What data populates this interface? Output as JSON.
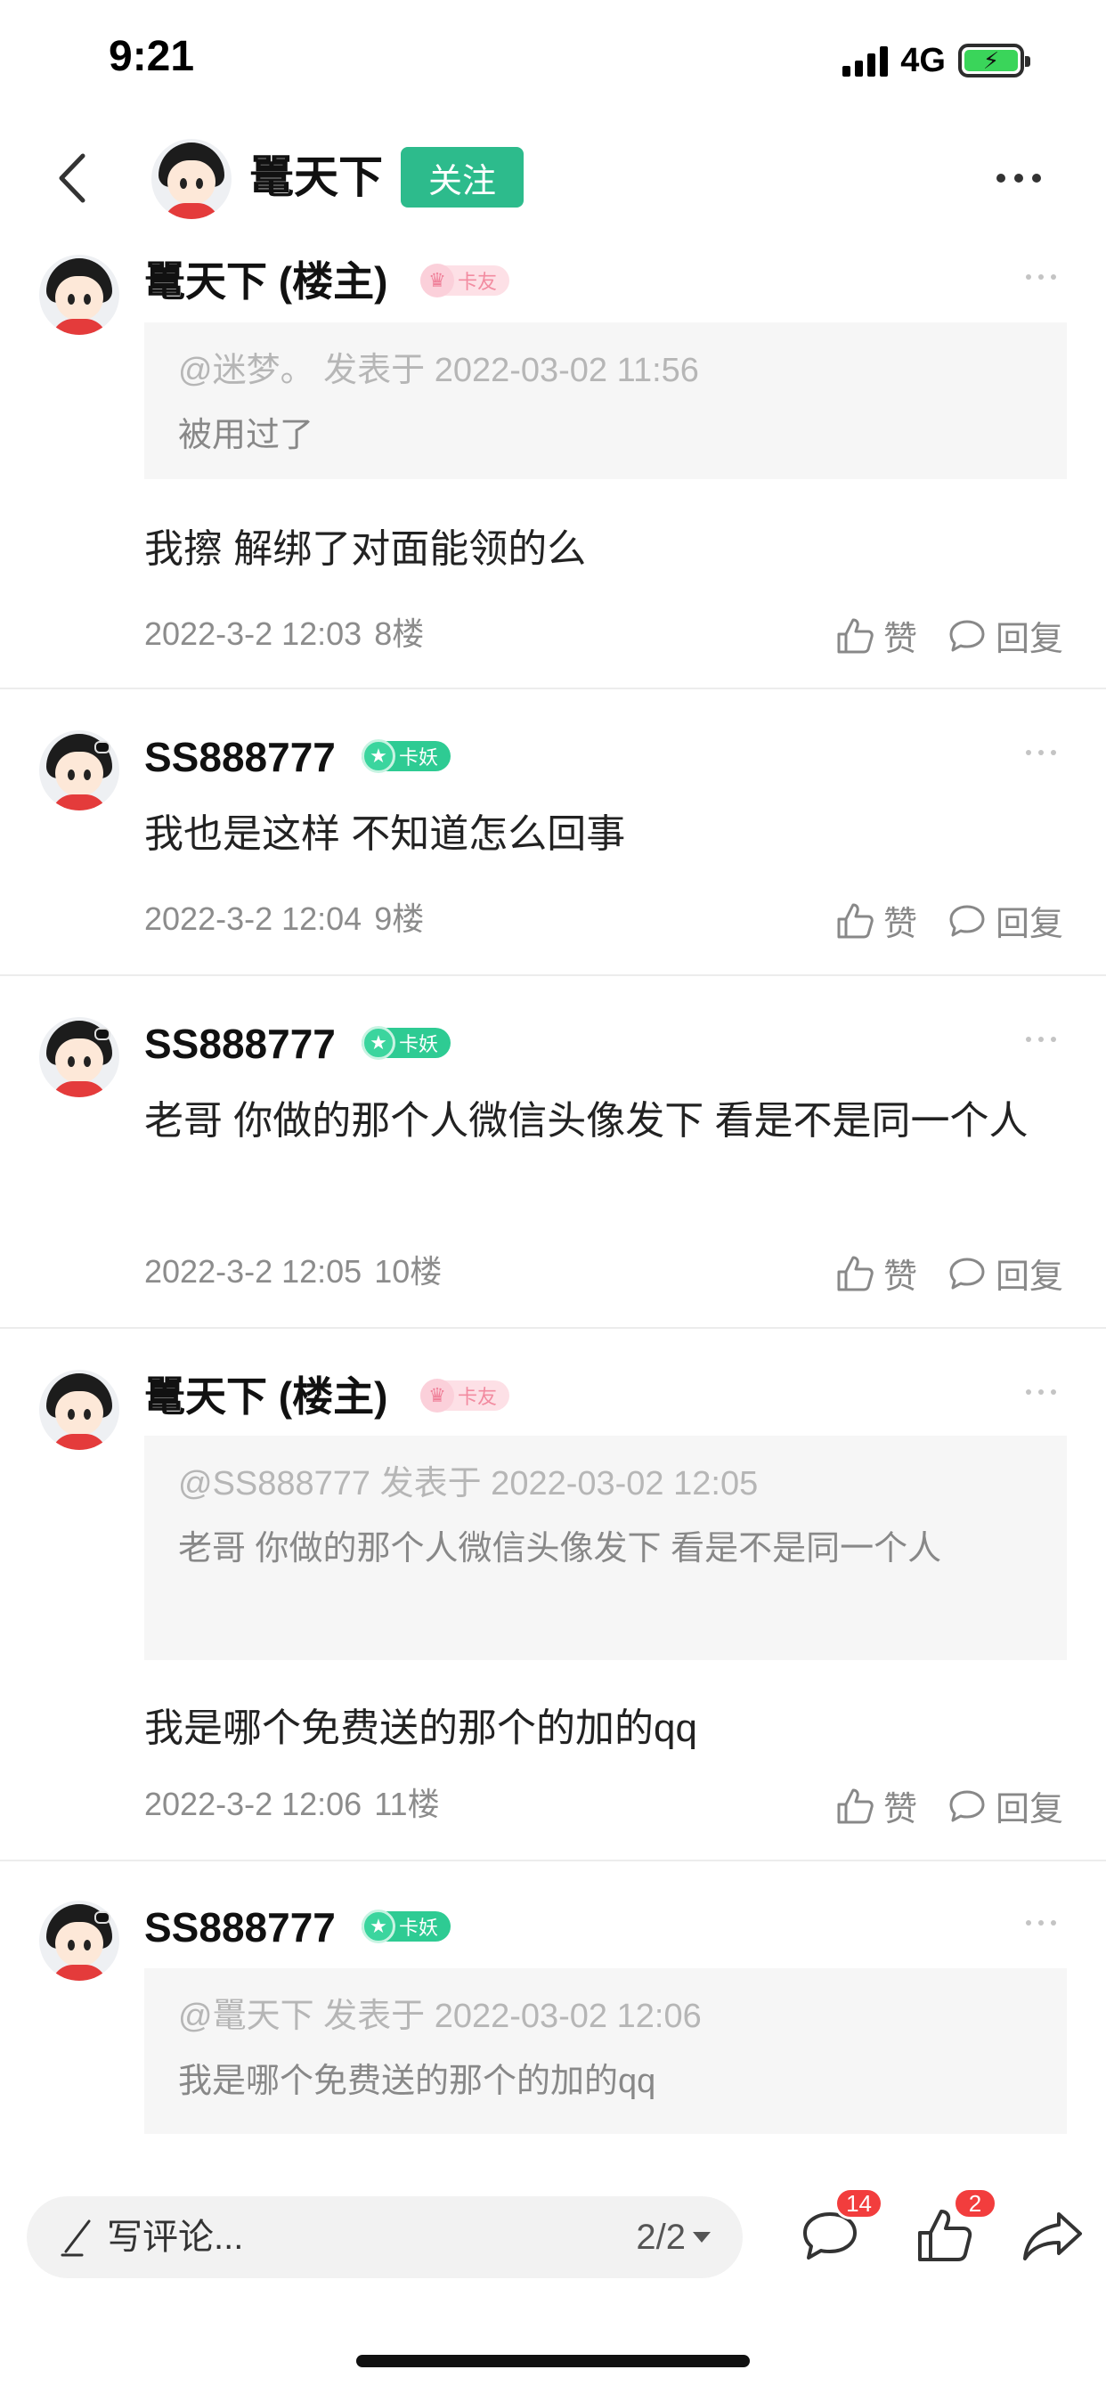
{
  "status_bar": {
    "time": "9:21",
    "network": "4G"
  },
  "nav": {
    "title": "鼍天下",
    "follow_label": "关注"
  },
  "posts": [
    {
      "name": "鼍天下 (楼主)",
      "badge": "卡友",
      "quote_meta": "@迷梦。 发表于 2022-03-02 11:56",
      "quote_text": "被用过了",
      "text": "我擦 解绑了对面能领的么",
      "date": "2022-3-2 12:03",
      "floor": "8楼",
      "like_label": "赞",
      "reply_label": "回复"
    },
    {
      "name": "SS888777",
      "badge": "卡妖",
      "text": "我也是这样 不知道怎么回事",
      "date": "2022-3-2 12:04",
      "floor": "9楼",
      "like_label": "赞",
      "reply_label": "回复"
    },
    {
      "name": "SS888777",
      "badge": "卡妖",
      "text": "老哥 你做的那个人微信头像发下 看是不是同一个人",
      "date": "2022-3-2 12:05",
      "floor": "10楼",
      "like_label": "赞",
      "reply_label": "回复"
    },
    {
      "name": "鼍天下 (楼主)",
      "badge": "卡友",
      "quote_meta": "@SS888777 发表于 2022-03-02 12:05",
      "quote_text": "老哥 你做的那个人微信头像发下 看是不是同一个人",
      "text": "我是哪个免费送的那个的加的qq",
      "date": "2022-3-2 12:06",
      "floor": "11楼",
      "like_label": "赞",
      "reply_label": "回复"
    },
    {
      "name": "SS888777",
      "badge": "卡妖",
      "quote_meta": "@鼍天下 发表于 2022-03-02 12:06",
      "quote_text": "我是哪个免费送的那个的加的qq"
    }
  ],
  "bottom_bar": {
    "comment_placeholder": "写评论...",
    "page_indicator": "2/2",
    "comment_count": "14",
    "like_count": "2"
  },
  "colors": {
    "accent": "#2dbb8c",
    "badge_red": "#f23d3d",
    "badge_green": "#2ecb93",
    "badge_pink": "#fde0e6"
  },
  "icons": [
    "back-arrow-icon",
    "more-icon",
    "thumb-up-icon",
    "comment-bubble-icon",
    "share-icon",
    "pen-icon",
    "star-icon",
    "crown-icon"
  ]
}
